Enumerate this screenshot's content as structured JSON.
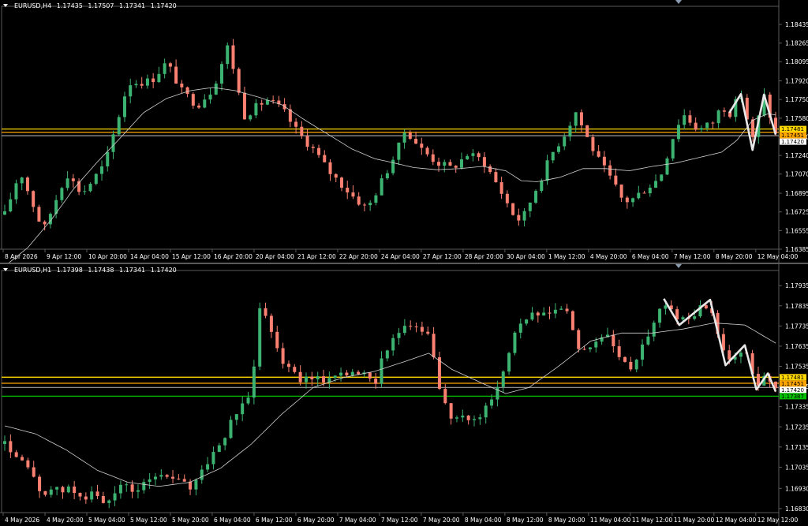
{
  "colors": {
    "background": "#000000",
    "bull": "#3cb371",
    "bear": "#fa8072",
    "grid": "#5a5a5a",
    "axis_text": "#ffffff",
    "ma": "#d0d0d0",
    "zigzag": "#e8e8e8",
    "level_gold": "#ffd700",
    "level_orange": "#ffa500",
    "level_green": "#00c000"
  },
  "chart_data": [
    {
      "type": "candlestick",
      "symbol": "EURUSD,H4",
      "ohlc_header": [
        "1.17435",
        "1.17507",
        "1.17341",
        "1.17420"
      ],
      "ylim": [
        1.16385,
        1.186
      ],
      "y_ticks": [
        "1.18435",
        "1.18265",
        "1.18095",
        "1.17920",
        "1.17750",
        "1.17580",
        "1.17410",
        "1.17240",
        "1.17070",
        "1.16895",
        "1.16725",
        "1.16555",
        "1.16385"
      ],
      "x_ticks": [
        "8 Apr 2026",
        "9 Apr 12:00",
        "10 Apr 20:00",
        "14 Apr 04:00",
        "15 Apr 12:00",
        "16 Apr 20:00",
        "20 Apr 04:00",
        "21 Apr 12:00",
        "22 Apr 20:00",
        "24 Apr 04:00",
        "27 Apr 12:00",
        "28 Apr 20:00",
        "30 Apr 04:00",
        "1 May 12:00",
        "4 May 20:00",
        "6 May 04:00",
        "7 May 12:00",
        "8 May 20:00",
        "12 May 04:00"
      ],
      "price_labels": [
        {
          "text": "1.17481",
          "price": 1.17481,
          "bg": "#ffd700"
        },
        {
          "text": "1.17451",
          "price": 1.17451,
          "bg": "#ffa500"
        },
        {
          "text": "1.17420",
          "price": 1.1742,
          "bg": "#ffffff"
        }
      ],
      "levels": [
        {
          "price": 1.17481,
          "color": "#ffd700"
        },
        {
          "price": 1.17451,
          "color": "#ffa500"
        },
        {
          "price": 1.1742,
          "color": "#8a8a8a"
        }
      ],
      "zigzag": [
        [
          0.94,
          1.1763
        ],
        [
          0.955,
          1.178
        ],
        [
          0.97,
          1.1729
        ],
        [
          0.985,
          1.17795
        ],
        [
          1.0,
          1.1743
        ]
      ],
      "ma_points": [
        [
          0.0,
          1.1623
        ],
        [
          0.03,
          1.164
        ],
        [
          0.06,
          1.1665
        ],
        [
          0.09,
          1.1694
        ],
        [
          0.12,
          1.1718
        ],
        [
          0.15,
          1.174
        ],
        [
          0.18,
          1.1763
        ],
        [
          0.21,
          1.1776
        ],
        [
          0.24,
          1.1783
        ],
        [
          0.27,
          1.1786
        ],
        [
          0.3,
          1.1783
        ],
        [
          0.33,
          1.1777
        ],
        [
          0.36,
          1.177
        ],
        [
          0.39,
          1.1756
        ],
        [
          0.42,
          1.1743
        ],
        [
          0.45,
          1.173
        ],
        [
          0.48,
          1.1721
        ],
        [
          0.5,
          1.1718
        ],
        [
          0.53,
          1.1713
        ],
        [
          0.56,
          1.1711
        ],
        [
          0.59,
          1.1712
        ],
        [
          0.62,
          1.1714
        ],
        [
          0.65,
          1.171
        ],
        [
          0.67,
          1.1701
        ],
        [
          0.69,
          1.17
        ],
        [
          0.72,
          1.1704
        ],
        [
          0.75,
          1.1712
        ],
        [
          0.78,
          1.1712
        ],
        [
          0.81,
          1.171
        ],
        [
          0.84,
          1.1714
        ],
        [
          0.87,
          1.1717
        ],
        [
          0.9,
          1.1722
        ],
        [
          0.93,
          1.1727
        ],
        [
          0.95,
          1.1738
        ],
        [
          0.97,
          1.1756
        ],
        [
          0.99,
          1.1762
        ],
        [
          1.0,
          1.1761
        ]
      ],
      "path": [
        [
          0.0,
          1.167
        ],
        [
          0.02,
          1.171
        ],
        [
          0.05,
          1.1655
        ],
        [
          0.08,
          1.1708
        ],
        [
          0.1,
          1.1689
        ],
        [
          0.13,
          1.1716
        ],
        [
          0.16,
          1.179
        ],
        [
          0.19,
          1.1792
        ],
        [
          0.21,
          1.1809
        ],
        [
          0.23,
          1.1782
        ],
        [
          0.25,
          1.177
        ],
        [
          0.27,
          1.1785
        ],
        [
          0.29,
          1.1825
        ],
        [
          0.31,
          1.176
        ],
        [
          0.34,
          1.1775
        ],
        [
          0.36,
          1.1766
        ],
        [
          0.38,
          1.1745
        ],
        [
          0.4,
          1.173
        ],
        [
          0.42,
          1.171
        ],
        [
          0.45,
          1.1688
        ],
        [
          0.47,
          1.1675
        ],
        [
          0.49,
          1.1702
        ],
        [
          0.51,
          1.173
        ],
        [
          0.52,
          1.1748
        ],
        [
          0.54,
          1.173
        ],
        [
          0.56,
          1.1718
        ],
        [
          0.58,
          1.1712
        ],
        [
          0.6,
          1.1725
        ],
        [
          0.62,
          1.172
        ],
        [
          0.64,
          1.1696
        ],
        [
          0.66,
          1.167
        ],
        [
          0.67,
          1.1664
        ],
        [
          0.69,
          1.1695
        ],
        [
          0.71,
          1.1726
        ],
        [
          0.73,
          1.1748
        ],
        [
          0.74,
          1.1765
        ],
        [
          0.755,
          1.1741
        ],
        [
          0.77,
          1.172
        ],
        [
          0.79,
          1.1698
        ],
        [
          0.8,
          1.1685
        ],
        [
          0.81,
          1.1682
        ],
        [
          0.83,
          1.1693
        ],
        [
          0.85,
          1.1704
        ],
        [
          0.87,
          1.1748
        ],
        [
          0.88,
          1.1762
        ],
        [
          0.9,
          1.1747
        ],
        [
          0.92,
          1.1755
        ],
        [
          0.93,
          1.177
        ],
        [
          0.94,
          1.1762
        ],
        [
          0.955,
          1.178
        ],
        [
          0.97,
          1.1738
        ],
        [
          0.985,
          1.1778
        ],
        [
          1.0,
          1.1743
        ]
      ],
      "candle_count": 136
    },
    {
      "type": "candlestick",
      "symbol": "EURUSD,H1",
      "ohlc_header": [
        "1.17398",
        "1.17438",
        "1.17341",
        "1.17420"
      ],
      "ylim": [
        1.1681,
        1.1801
      ],
      "y_ticks": [
        "1.17935",
        "1.17835",
        "1.17735",
        "1.17635",
        "1.17535",
        "1.17435",
        "1.17335",
        "1.17235",
        "1.17135",
        "1.17035",
        "1.16930",
        "1.16830"
      ],
      "x_ticks": [
        "4 May 2026",
        "4 May 20:00",
        "5 May 04:00",
        "5 May 12:00",
        "5 May 20:00",
        "6 May 04:00",
        "6 May 12:00",
        "6 May 20:00",
        "7 May 04:00",
        "7 May 12:00",
        "7 May 20:00",
        "8 May 04:00",
        "8 May 12:00",
        "8 May 20:00",
        "11 May 04:00",
        "11 May 12:00",
        "11 May 20:00",
        "12 May 04:00",
        "12 May 12:00"
      ],
      "price_labels": [
        {
          "text": "1.17481",
          "price": 1.17481,
          "bg": "#ffd700"
        },
        {
          "text": "1.17451",
          "price": 1.17451,
          "bg": "#ffa500"
        },
        {
          "text": "1.17420",
          "price": 1.1742,
          "bg": "#ffffff"
        },
        {
          "text": "1.17387",
          "price": 1.17387,
          "bg": "#00c000"
        }
      ],
      "levels": [
        {
          "price": 1.17481,
          "color": "#ffd700"
        },
        {
          "price": 1.17451,
          "color": "#ffa500"
        },
        {
          "price": 1.1743,
          "color": "#8a8a8a"
        },
        {
          "price": 1.17387,
          "color": "#00c000"
        }
      ],
      "zigzag": [
        [
          0.855,
          1.1787
        ],
        [
          0.875,
          1.1774
        ],
        [
          0.915,
          1.17865
        ],
        [
          0.935,
          1.1754
        ],
        [
          0.96,
          1.1764
        ],
        [
          0.975,
          1.1742
        ],
        [
          0.99,
          1.175
        ],
        [
          1.0,
          1.1741
        ]
      ],
      "ma_points": [
        [
          0.0,
          1.1724
        ],
        [
          0.04,
          1.172
        ],
        [
          0.08,
          1.1712
        ],
        [
          0.12,
          1.1702
        ],
        [
          0.16,
          1.1696
        ],
        [
          0.2,
          1.1694
        ],
        [
          0.24,
          1.1696
        ],
        [
          0.28,
          1.1703
        ],
        [
          0.32,
          1.1715
        ],
        [
          0.36,
          1.173
        ],
        [
          0.4,
          1.1743
        ],
        [
          0.44,
          1.1748
        ],
        [
          0.48,
          1.1751
        ],
        [
          0.52,
          1.1756
        ],
        [
          0.55,
          1.176
        ],
        [
          0.58,
          1.1752
        ],
        [
          0.62,
          1.1745
        ],
        [
          0.65,
          1.174
        ],
        [
          0.68,
          1.1743
        ],
        [
          0.72,
          1.1754
        ],
        [
          0.76,
          1.1766
        ],
        [
          0.8,
          1.177
        ],
        [
          0.84,
          1.177
        ],
        [
          0.88,
          1.1772
        ],
        [
          0.92,
          1.1775
        ],
        [
          0.96,
          1.1774
        ],
        [
          1.0,
          1.1765
        ]
      ],
      "path": [
        [
          0.0,
          1.1715
        ],
        [
          0.03,
          1.1702
        ],
        [
          0.05,
          1.169
        ],
        [
          0.08,
          1.1693
        ],
        [
          0.1,
          1.1689
        ],
        [
          0.12,
          1.169
        ],
        [
          0.13,
          1.1683
        ],
        [
          0.15,
          1.1696
        ],
        [
          0.17,
          1.169
        ],
        [
          0.19,
          1.17
        ],
        [
          0.22,
          1.1698
        ],
        [
          0.24,
          1.1693
        ],
        [
          0.26,
          1.1705
        ],
        [
          0.28,
          1.1715
        ],
        [
          0.3,
          1.173
        ],
        [
          0.32,
          1.174
        ],
        [
          0.33,
          1.1785
        ],
        [
          0.345,
          1.1773
        ],
        [
          0.36,
          1.1756
        ],
        [
          0.38,
          1.1748
        ],
        [
          0.4,
          1.1746
        ],
        [
          0.42,
          1.1748
        ],
        [
          0.44,
          1.1751
        ],
        [
          0.46,
          1.175
        ],
        [
          0.48,
          1.1745
        ],
        [
          0.49,
          1.176
        ],
        [
          0.51,
          1.177
        ],
        [
          0.53,
          1.1774
        ],
        [
          0.55,
          1.1768
        ],
        [
          0.56,
          1.175
        ],
        [
          0.57,
          1.1735
        ],
        [
          0.58,
          1.1726
        ],
        [
          0.6,
          1.1728
        ],
        [
          0.62,
          1.173
        ],
        [
          0.63,
          1.1738
        ],
        [
          0.64,
          1.1742
        ],
        [
          0.66,
          1.177
        ],
        [
          0.68,
          1.1779
        ],
        [
          0.7,
          1.1778
        ],
        [
          0.72,
          1.1783
        ],
        [
          0.73,
          1.178
        ],
        [
          0.745,
          1.176
        ],
        [
          0.76,
          1.1764
        ],
        [
          0.78,
          1.177
        ],
        [
          0.8,
          1.1756
        ],
        [
          0.81,
          1.1751
        ],
        [
          0.82,
          1.1759
        ],
        [
          0.835,
          1.177
        ],
        [
          0.855,
          1.1786
        ],
        [
          0.875,
          1.1776
        ],
        [
          0.895,
          1.178
        ],
        [
          0.915,
          1.1785
        ],
        [
          0.935,
          1.1756
        ],
        [
          0.95,
          1.1758
        ],
        [
          0.96,
          1.1762
        ],
        [
          0.975,
          1.1743
        ],
        [
          0.99,
          1.1749
        ],
        [
          1.0,
          1.1741
        ]
      ],
      "candle_count": 134
    }
  ]
}
